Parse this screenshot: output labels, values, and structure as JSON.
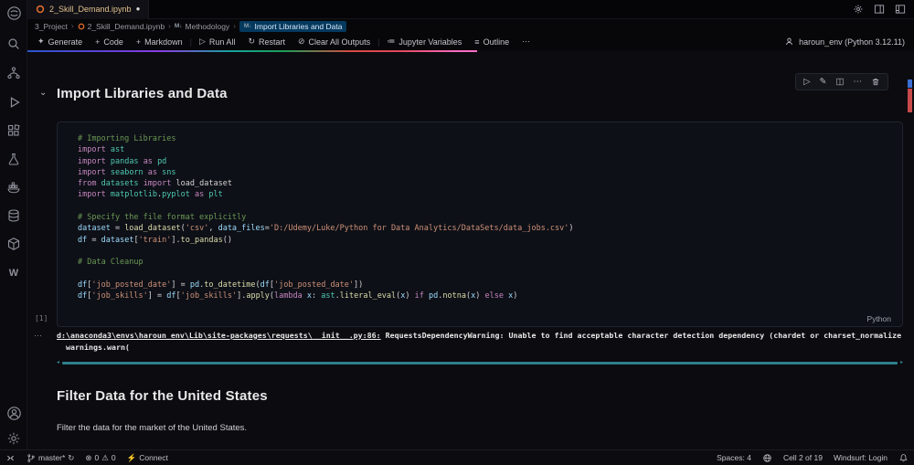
{
  "window": {
    "tab_title": "2_Skill_Demand.ipynb",
    "dirty_dot": "●"
  },
  "icons": {
    "markdown_breadcrumb": "M↓",
    "sparkle": "✦",
    "plus": "+",
    "run": "▷",
    "restart": "↻",
    "clear": "⊘",
    "outline": "≡",
    "variables": "≔",
    "more": "⋯",
    "chevron_down": "⌄",
    "pencil": "✎",
    "split_cell": "◫",
    "scroll_left": "◂",
    "scroll_right": "▸",
    "sync": "↻",
    "error": "⊗",
    "warning": "⚠",
    "lightning": "⚡"
  },
  "breadcrumbs": {
    "items": [
      {
        "label": "3_Project"
      },
      {
        "label": "2_Skill_Demand.ipynb"
      },
      {
        "label": "Methodology"
      },
      {
        "label": "Import Libraries and Data"
      }
    ]
  },
  "notebook_toolbar": {
    "generate": "Generate",
    "add_code": "Code",
    "add_markdown": "Markdown",
    "run_all": "Run All",
    "restart": "Restart",
    "clear_all": "Clear All Outputs",
    "jupyter_variables": "Jupyter Variables",
    "outline": "Outline",
    "kernel": "haroun_env (Python 3.12.11)"
  },
  "markdown_cell": {
    "heading": "Import Libraries and Data"
  },
  "code_cell": {
    "execution_count": "[1]",
    "language": "Python",
    "lines": [
      [
        [
          "cm",
          "# Importing Libraries"
        ]
      ],
      [
        [
          "kw",
          "import"
        ],
        [
          "pl",
          " "
        ],
        [
          "mod",
          "ast"
        ]
      ],
      [
        [
          "kw",
          "import"
        ],
        [
          "pl",
          " "
        ],
        [
          "mod",
          "pandas"
        ],
        [
          "pl",
          " "
        ],
        [
          "kw",
          "as"
        ],
        [
          "pl",
          " "
        ],
        [
          "mod",
          "pd"
        ]
      ],
      [
        [
          "kw",
          "import"
        ],
        [
          "pl",
          " "
        ],
        [
          "mod",
          "seaborn"
        ],
        [
          "pl",
          " "
        ],
        [
          "kw",
          "as"
        ],
        [
          "pl",
          " "
        ],
        [
          "mod",
          "sns"
        ]
      ],
      [
        [
          "kw",
          "from"
        ],
        [
          "pl",
          " "
        ],
        [
          "mod",
          "datasets"
        ],
        [
          "pl",
          " "
        ],
        [
          "kw",
          "import"
        ],
        [
          "pl",
          " "
        ],
        [
          "pl",
          "load_dataset"
        ]
      ],
      [
        [
          "kw",
          "import"
        ],
        [
          "pl",
          " "
        ],
        [
          "mod",
          "matplotlib"
        ],
        [
          "pl",
          "."
        ],
        [
          "mod",
          "pyplot"
        ],
        [
          "pl",
          " "
        ],
        [
          "kw",
          "as"
        ],
        [
          "pl",
          " "
        ],
        [
          "mod",
          "plt"
        ]
      ],
      [],
      [
        [
          "cm",
          "# Specify the file format explicitly"
        ]
      ],
      [
        [
          "var",
          "dataset"
        ],
        [
          "pl",
          " = "
        ],
        [
          "fn",
          "load_dataset"
        ],
        [
          "pl",
          "("
        ],
        [
          "str",
          "'csv'"
        ],
        [
          "pl",
          ", "
        ],
        [
          "var",
          "data_files"
        ],
        [
          "pl",
          "="
        ],
        [
          "str",
          "'D:/Udemy/Luke/Python for Data Analytics/DataSets/data_jobs.csv'"
        ],
        [
          "pl",
          ")"
        ]
      ],
      [
        [
          "var",
          "df"
        ],
        [
          "pl",
          " = "
        ],
        [
          "var",
          "dataset"
        ],
        [
          "pl",
          "["
        ],
        [
          "str",
          "'train'"
        ],
        [
          "pl",
          "]."
        ],
        [
          "fn",
          "to_pandas"
        ],
        [
          "pl",
          "()"
        ]
      ],
      [],
      [
        [
          "cm",
          "# Data Cleanup"
        ]
      ],
      [],
      [
        [
          "var",
          "df"
        ],
        [
          "pl",
          "["
        ],
        [
          "str",
          "'job_posted_date'"
        ],
        [
          "pl",
          "] = "
        ],
        [
          "var",
          "pd"
        ],
        [
          "pl",
          "."
        ],
        [
          "fn",
          "to_datetime"
        ],
        [
          "pl",
          "("
        ],
        [
          "var",
          "df"
        ],
        [
          "pl",
          "["
        ],
        [
          "str",
          "'job_posted_date'"
        ],
        [
          "pl",
          "])"
        ]
      ],
      [
        [
          "var",
          "df"
        ],
        [
          "pl",
          "["
        ],
        [
          "str",
          "'job_skills'"
        ],
        [
          "pl",
          "] = "
        ],
        [
          "var",
          "df"
        ],
        [
          "pl",
          "["
        ],
        [
          "str",
          "'job_skills'"
        ],
        [
          "pl",
          "]."
        ],
        [
          "fn",
          "apply"
        ],
        [
          "pl",
          "("
        ],
        [
          "kw",
          "lambda"
        ],
        [
          "pl",
          " "
        ],
        [
          "var",
          "x"
        ],
        [
          "pl",
          ": "
        ],
        [
          "mod",
          "ast"
        ],
        [
          "pl",
          "."
        ],
        [
          "fn",
          "literal_eval"
        ],
        [
          "pl",
          "("
        ],
        [
          "var",
          "x"
        ],
        [
          "pl",
          ") "
        ],
        [
          "kw",
          "if"
        ],
        [
          "pl",
          " "
        ],
        [
          "var",
          "pd"
        ],
        [
          "pl",
          "."
        ],
        [
          "fn",
          "notna"
        ],
        [
          "pl",
          "("
        ],
        [
          "var",
          "x"
        ],
        [
          "pl",
          ") "
        ],
        [
          "kw",
          "else"
        ],
        [
          "pl",
          " "
        ],
        [
          "var",
          "x"
        ],
        [
          "pl",
          ")"
        ]
      ]
    ]
  },
  "output": {
    "collapse": "⋯",
    "link": "d:\\anaconda3\\envs\\haroun_env\\Lib\\site-packages\\requests\\__init__.py:86:",
    "message": " RequestsDependencyWarning: Unable to find acceptable character detection dependency (chardet or charset_normalize",
    "line2": "warnings.warn("
  },
  "next_cell": {
    "heading": "Filter Data for the United States",
    "paragraph": "Filter the data for the market of the United States."
  },
  "statusbar": {
    "branch": "master*",
    "errors": "0",
    "warnings": "0",
    "connect": "Connect",
    "spaces": "Spaces: 4",
    "cell_position": "Cell 2 of 19",
    "windsurf": "Windsurf: Login"
  },
  "colors": {
    "breadcrumb_highlight": "#04395e",
    "scrollbar_teal": "#2e7f8c",
    "tab_modified": "#e2c08d",
    "comment_green": "#6a9955",
    "keyword_purple": "#c586c0",
    "string_orange": "#ce9178"
  }
}
